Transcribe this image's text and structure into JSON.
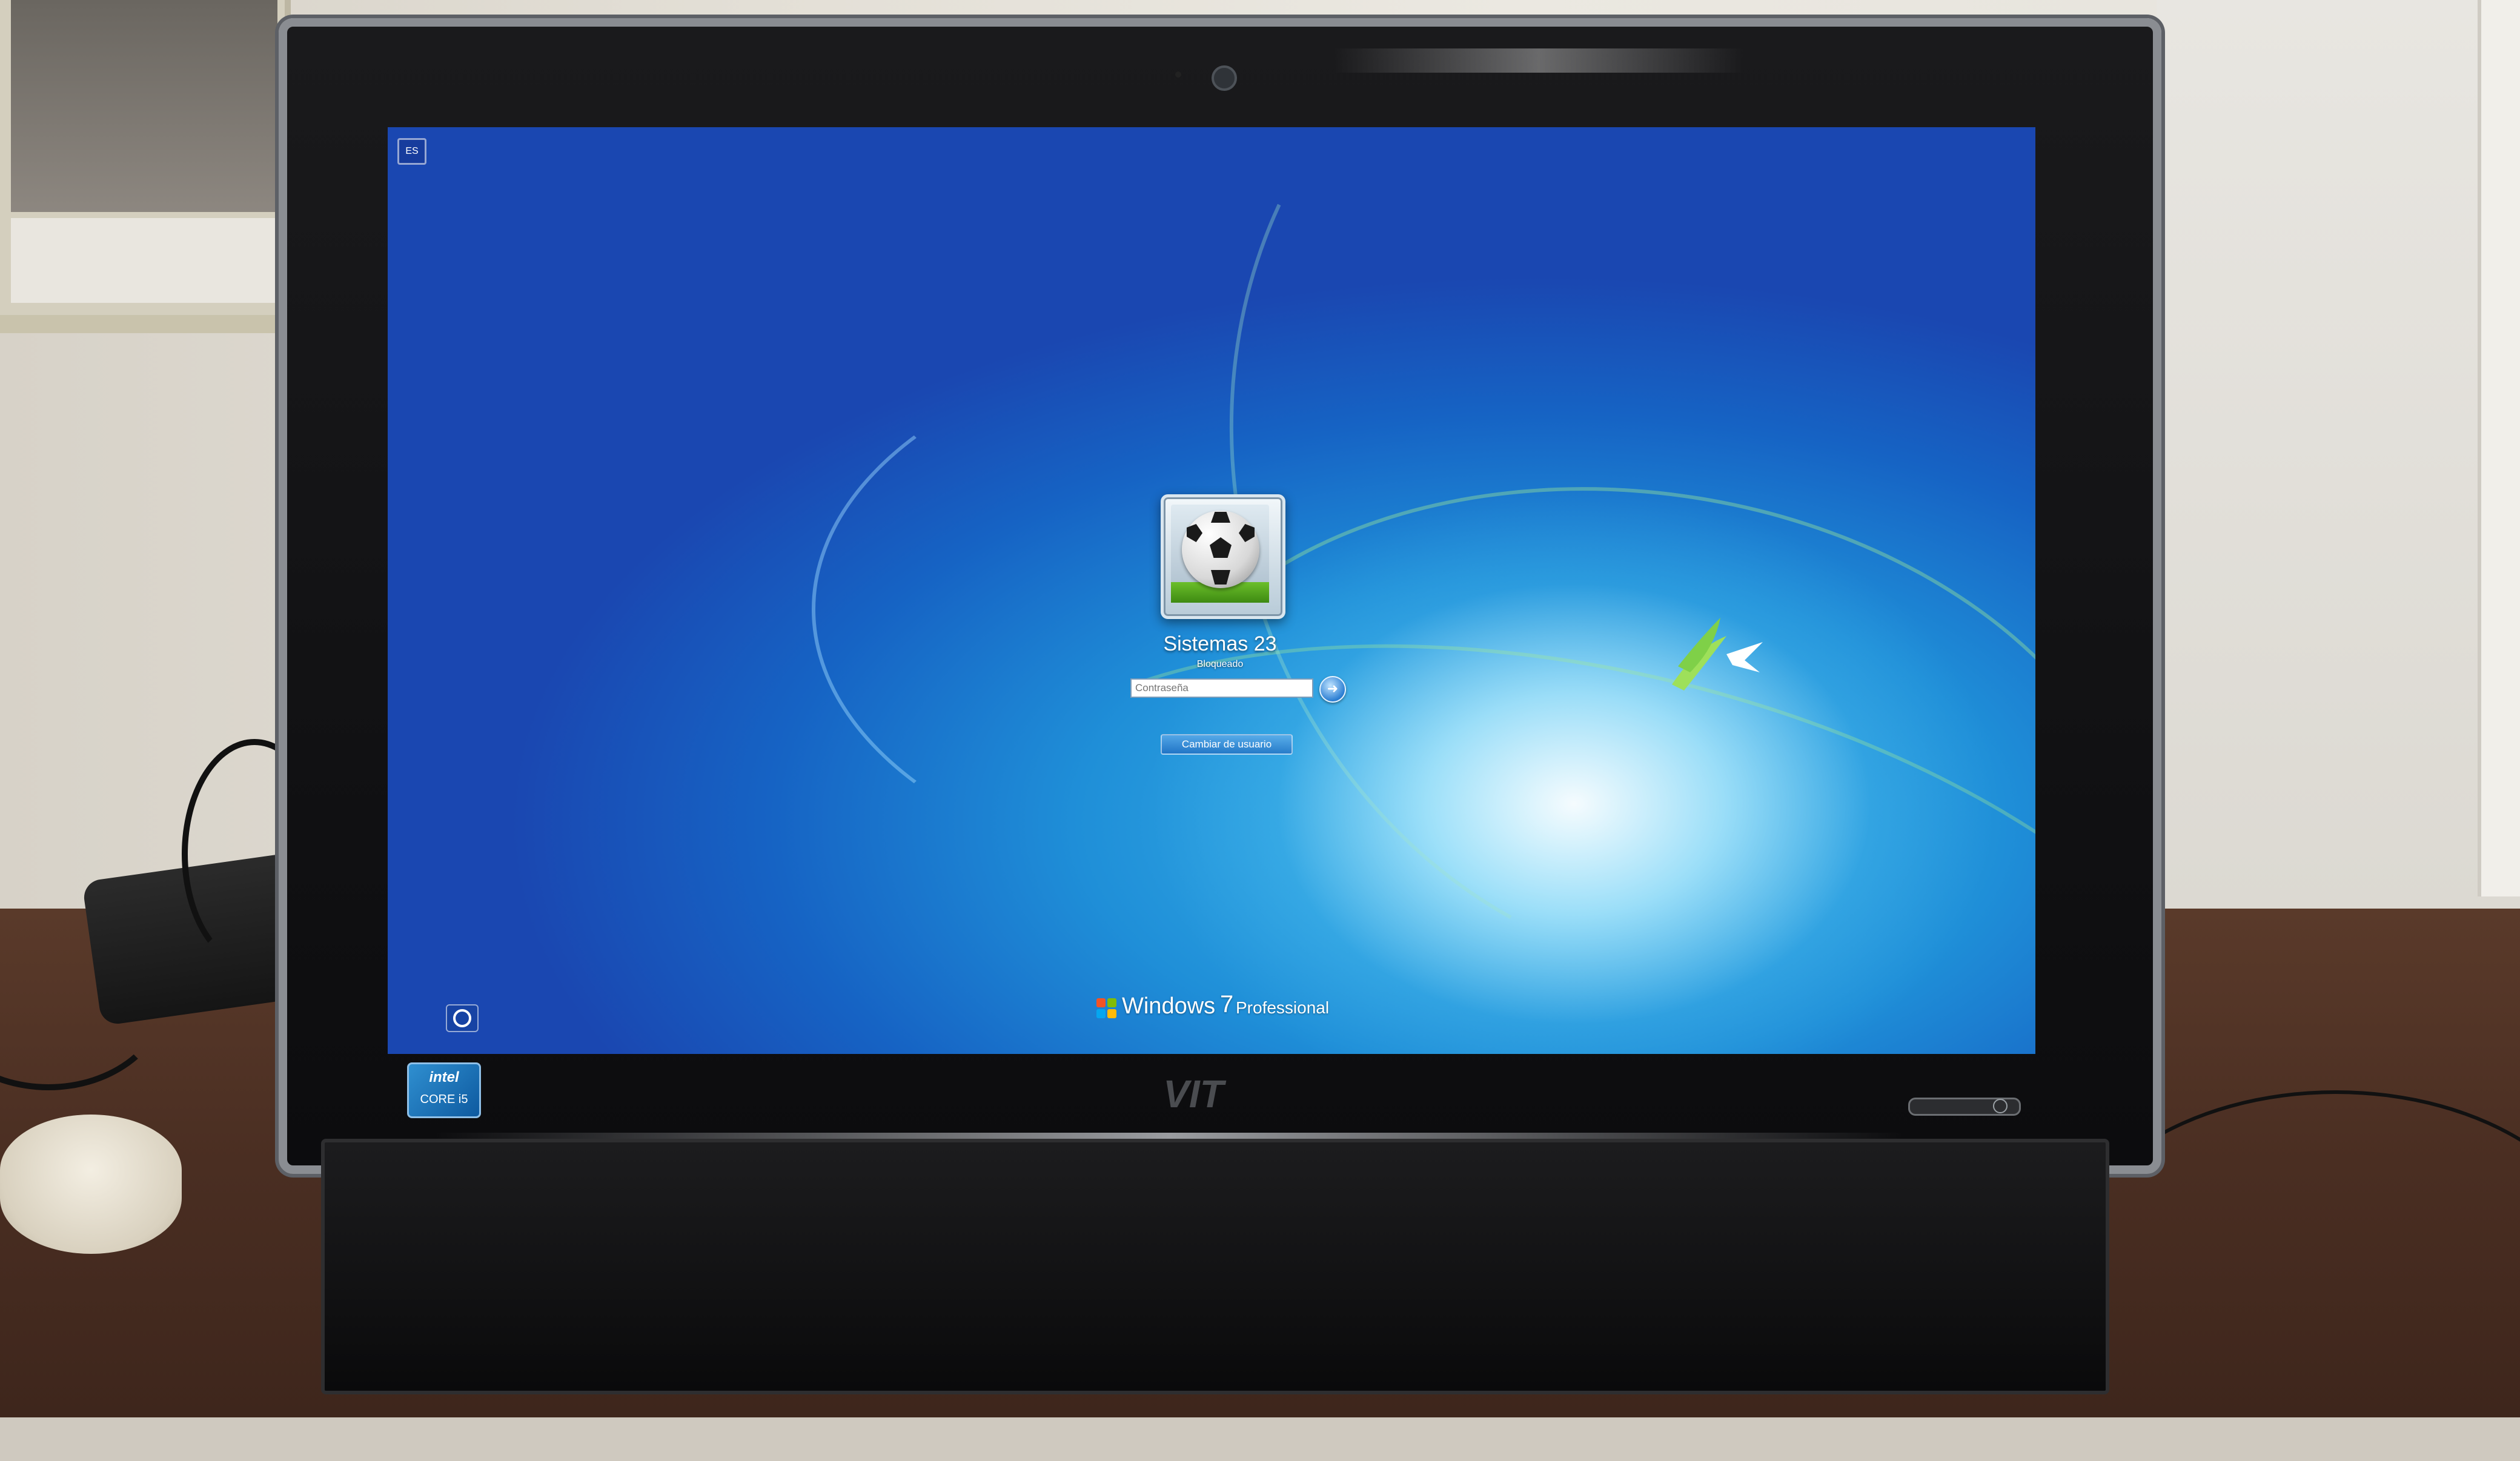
{
  "screen": {
    "language_indicator": "ES",
    "user": {
      "name": "Sistemas 23",
      "status": "Bloqueado"
    },
    "password_field": {
      "value": "",
      "placeholder": "Contraseña"
    },
    "switch_user_label": "Cambiar de usuario",
    "os_brand": {
      "word": "Windows",
      "version": "7",
      "edition": "Professional"
    }
  },
  "monitor": {
    "badge_brand": "intel",
    "badge_model": "CORE i5"
  },
  "colors": {
    "wallpaper_deep": "#1a47b1",
    "wallpaper_light": "#3fb9ec",
    "input_border": "#7f9db9"
  }
}
